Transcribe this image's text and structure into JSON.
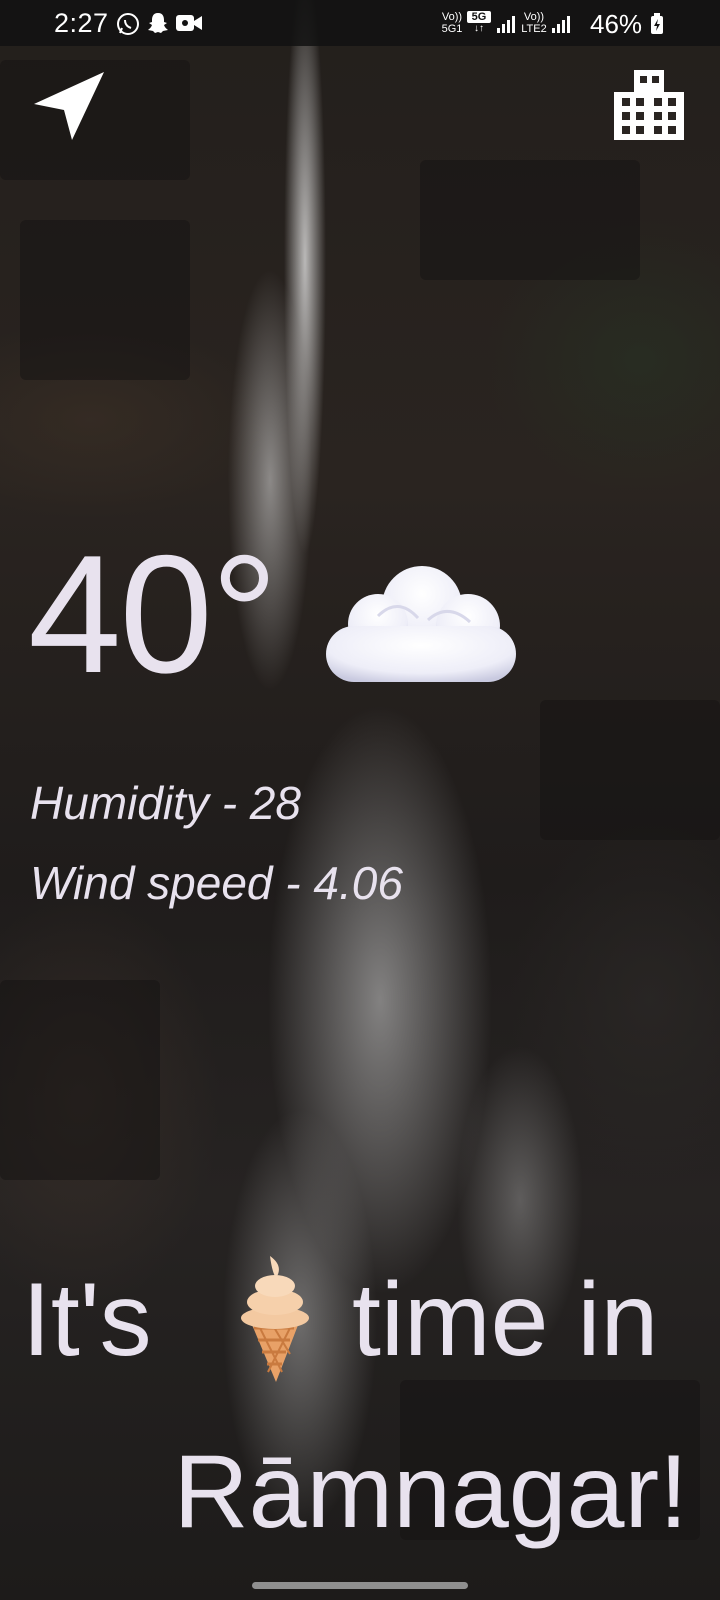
{
  "status_bar": {
    "time": "2:27",
    "notification_icons": [
      "whatsapp-icon",
      "snapchat-icon",
      "video-camera-icon"
    ],
    "sim1_label_top": "Vo))",
    "sim1_label_bottom": "5G1",
    "network_badge": "5G",
    "sim2_label_top": "Vo))",
    "sim2_label_bottom": "LTE2",
    "battery": "46%"
  },
  "toolbar": {
    "left_icon": "location-arrow-icon",
    "right_icon": "city-buildings-icon"
  },
  "weather": {
    "temperature": "40°",
    "condition_icon": "cloud-icon",
    "humidity_text": "Humidity - 28",
    "wind_text": "Wind speed - 4.06"
  },
  "message": {
    "line1_before": "It's",
    "line1_emoji": "ice-cream-icon",
    "line1_after": "time in",
    "line2": "Rāmnagar!"
  },
  "colors": {
    "text": "#e8e2ee",
    "status_bar_bg": "#121212"
  }
}
